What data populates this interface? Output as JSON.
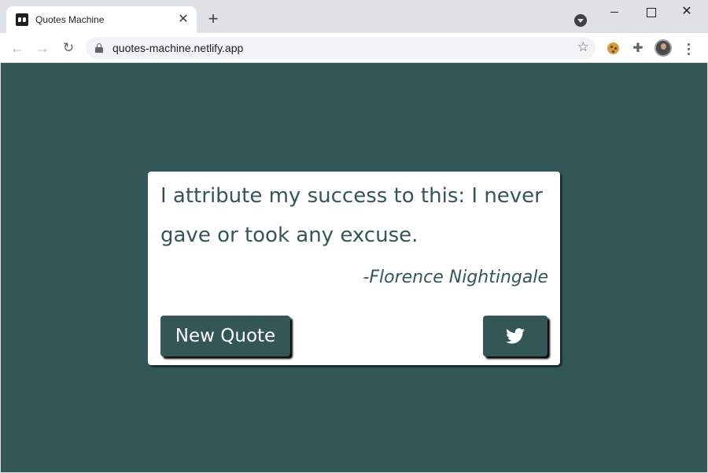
{
  "browser": {
    "tab_title": "Quotes Machine",
    "tab_close_symbol": "✕",
    "new_tab_symbol": "+",
    "window_close_symbol": "✕",
    "back_symbol": "←",
    "forward_symbol": "→",
    "reload_symbol": "↻",
    "url": "quotes-machine.netlify.app",
    "star_symbol": "☆",
    "puzzle_symbol": "✚"
  },
  "page": {
    "background_color": "#335656",
    "quote": "I attribute my success to this: I never gave or took any excuse.",
    "author": "-Florence Nightingale",
    "new_quote_label": "New Quote",
    "tweet_icon": "twitter-icon"
  }
}
